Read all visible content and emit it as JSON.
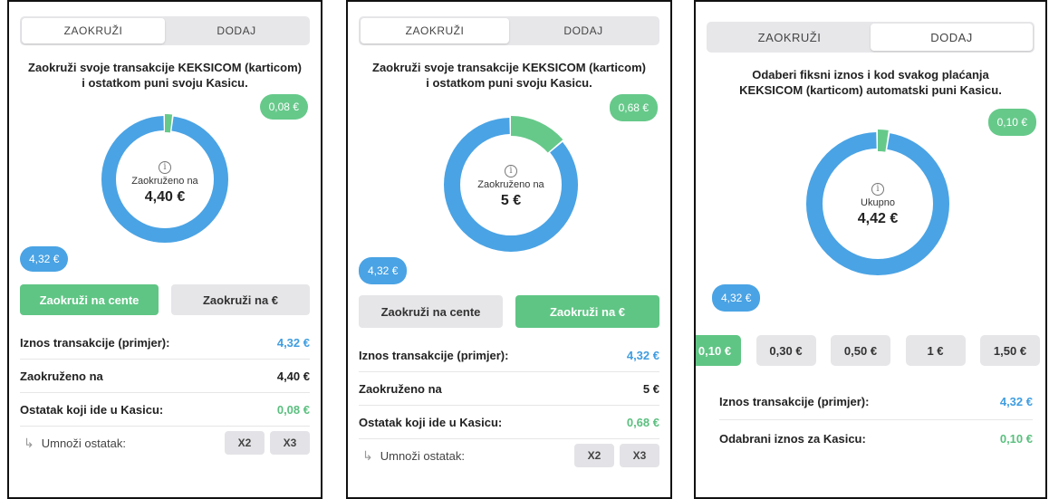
{
  "colors": {
    "green": "#66c98a",
    "blue": "#4aa3e4",
    "grey": "#e6e6e9"
  },
  "screen1": {
    "tabs": [
      "ZAOKRUŽI",
      "DODAJ"
    ],
    "active_tab": 0,
    "heading_line1": "Zaokruži svoje transakcije KEKSICOM (karticom)",
    "heading_line2": "i ostatkom puni svoju Kasicu.",
    "green_pill": "0,08 €",
    "blue_pill": "4,32 €",
    "center_label": "Zaokruženo na",
    "center_value": "4,40 €",
    "donut_fraction": 0.982,
    "button_cents": "Zaokruži na cente",
    "button_euro": "Zaokruži na €",
    "active_button": "cents",
    "rows": [
      {
        "label": "Iznos transakcije (primjer):",
        "value": "4,32 €",
        "color": "blue"
      },
      {
        "label": "Zaokruženo na",
        "value": "4,40 €",
        "color": ""
      },
      {
        "label": "Ostatak koji ide u Kasicu:",
        "value": "0,08 €",
        "color": "green"
      }
    ],
    "multiply_label": "Umnoži ostatak:",
    "x2": "X2",
    "x3": "X3"
  },
  "screen2": {
    "tabs": [
      "ZAOKRUŽI",
      "DODAJ"
    ],
    "active_tab": 0,
    "heading_line1": "Zaokruži svoje transakcije KEKSICOM (karticom)",
    "heading_line2": "i ostatkom puni svoju Kasicu.",
    "green_pill": "0,68 €",
    "blue_pill": "4,32 €",
    "center_label": "Zaokruženo na",
    "center_value": "5 €",
    "donut_fraction": 0.864,
    "button_cents": "Zaokruži na cente",
    "button_euro": "Zaokruži na €",
    "active_button": "euro",
    "rows": [
      {
        "label": "Iznos transakcije (primjer):",
        "value": "4,32 €",
        "color": "blue"
      },
      {
        "label": "Zaokruženo na",
        "value": "5 €",
        "color": ""
      },
      {
        "label": "Ostatak koji ide u Kasicu:",
        "value": "0,68 €",
        "color": "green"
      }
    ],
    "multiply_label": "Umnoži ostatak:",
    "x2": "X2",
    "x3": "X3"
  },
  "screen3": {
    "tabs": [
      "ZAOKRUŽI",
      "DODAJ"
    ],
    "active_tab": 1,
    "heading_line1": "Odaberi fiksni iznos i kod svakog plaćanja",
    "heading_line2": "KEKSICOM (karticom) automatski puni Kasicu.",
    "green_pill": "0,10 €",
    "blue_pill": "4,32 €",
    "center_label": "Ukupno",
    "center_value": "4,42 €",
    "donut_fraction": 0.977,
    "amounts": [
      "0,10 €",
      "0,30 €",
      "0,50 €",
      "1 €",
      "1,50 €"
    ],
    "active_amount": 0,
    "rows": [
      {
        "label": "Iznos transakcije (primjer):",
        "value": "4,32 €",
        "color": "blue"
      },
      {
        "label": "Odabrani iznos za Kasicu:",
        "value": "0,10 €",
        "color": "green"
      }
    ]
  }
}
